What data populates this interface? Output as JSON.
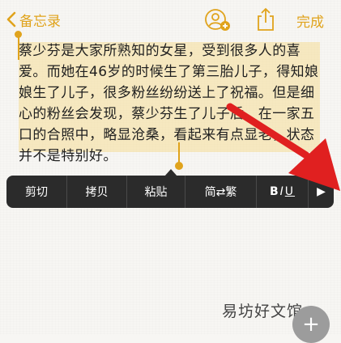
{
  "nav": {
    "back_label": "备忘录",
    "done_label": "完成"
  },
  "note": {
    "text": "蔡少芬是大家所熟知的女星，受到很多人的喜爱。而她在46岁的时候生了第三胎儿子，得知娘娘生了儿子，很多粉丝纷纷送上了祝福。但是细心的粉丝会发现，蔡少芬生了儿子后，在一家五口的合照中，略显沧桑，看起来有点显老，状态并不是特别好。"
  },
  "edit_menu": {
    "cut": "剪切",
    "copy": "拷贝",
    "paste": "粘贴",
    "convert": "简⇄繁",
    "format_b": "B",
    "format_i": "I",
    "format_u": "U",
    "more": "▶"
  },
  "watermark": "易坊好文馆",
  "fab_symbol": "+",
  "colors": {
    "accent": "#e0a31c",
    "menu_bg": "#2b2b2b",
    "selection": "#f6dd96",
    "annotation_arrow": "#e02020"
  },
  "icons": [
    "chevron-left-icon",
    "add-person-icon",
    "share-upload-icon",
    "red-arrow-icon",
    "plus-icon"
  ]
}
